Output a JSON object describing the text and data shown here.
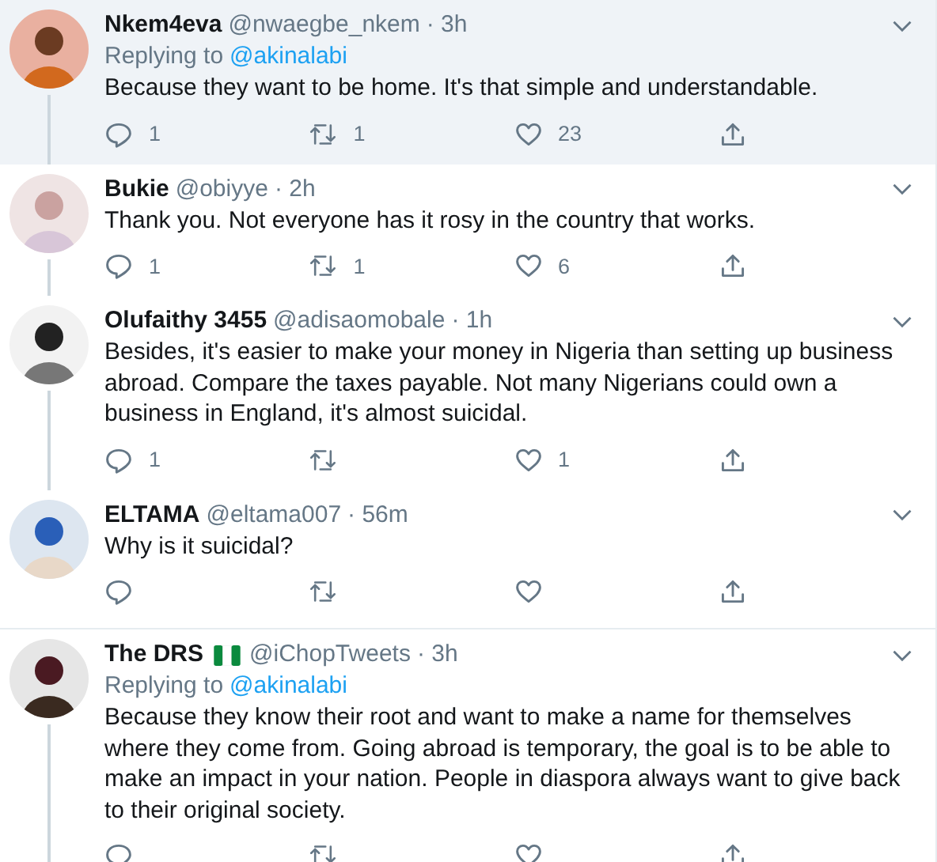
{
  "tweets": [
    {
      "name": "Nkem4eva",
      "flag": false,
      "handle": "@nwaegbe_nkem",
      "time": "· 3h",
      "replying_label": "Replying to",
      "replying_to": "@akinalabi",
      "text": "Because they want to be home. It's that simple and understandable.",
      "replies": "1",
      "retweets": "1",
      "likes": "23",
      "selected": true,
      "connector": true,
      "thread_start": false
    },
    {
      "name": "Bukie",
      "flag": false,
      "handle": "@obiyye",
      "time": "· 2h",
      "text": "Thank you. Not everyone has it rosy in the country that works.",
      "replies": "1",
      "retweets": "1",
      "likes": "6",
      "selected": false,
      "connector": true,
      "thread_start": false
    },
    {
      "name": "Olufaithy 3455",
      "flag": false,
      "handle": "@adisaomobale",
      "time": "· 1h",
      "text": "Besides, it's easier to make your money in Nigeria than setting up business abroad. Compare the taxes payable. Not many Nigerians could own a business in England, it's almost suicidal.",
      "replies": "1",
      "likes": "1",
      "selected": false,
      "connector": true,
      "thread_start": false
    },
    {
      "name": "ELTAMA",
      "flag": false,
      "handle": "@eltama007",
      "time": "· 56m",
      "text": "Why is it suicidal?",
      "selected": false,
      "connector": false,
      "thread_start": false
    },
    {
      "name": "The DRS",
      "flag": true,
      "handle": "@iChopTweets",
      "time": "· 3h",
      "replying_label": "Replying to",
      "replying_to": "@akinalabi",
      "text": "Because they know their root and want to make a name for themselves where they come from. Going abroad is temporary, the goal is to be able to make an impact in your nation. People in diaspora always want to give back to their original society.",
      "selected": false,
      "connector": true,
      "thread_start": true
    }
  ]
}
